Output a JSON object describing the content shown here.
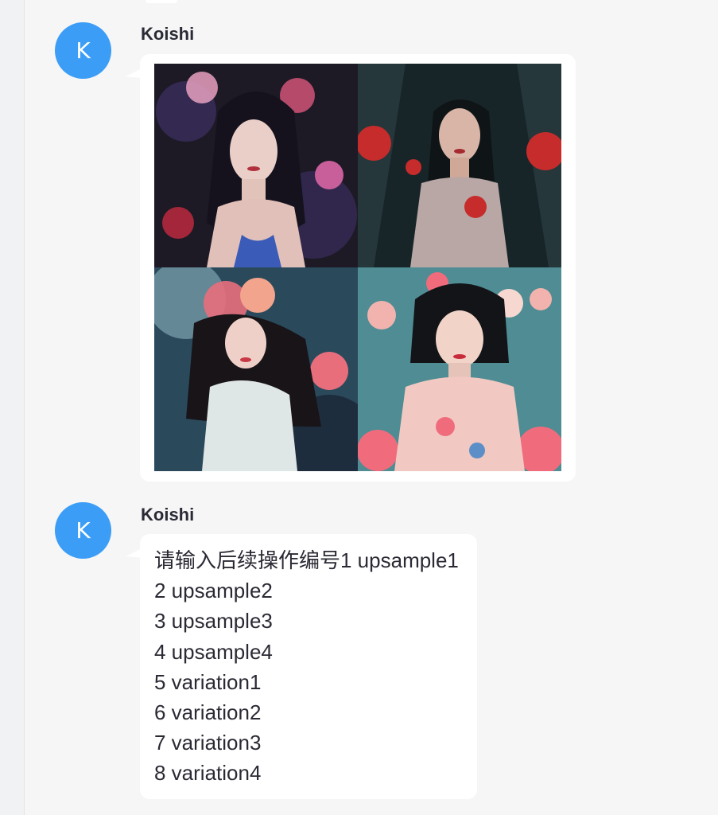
{
  "messages": [
    {
      "avatar_letter": "K",
      "username": "Koishi",
      "image_grid": {
        "tiles": [
          {
            "index": 1,
            "palette": [
              "#1d1a26",
              "#3a2d5c",
              "#b64a6a",
              "#e8a0c0"
            ]
          },
          {
            "index": 2,
            "palette": [
              "#172529",
              "#2e4446",
              "#c62c2b",
              "#d9b5a8"
            ]
          },
          {
            "index": 3,
            "palette": [
              "#2a4a5c",
              "#7fa2b0",
              "#e86e7c",
              "#f3d6d2"
            ]
          },
          {
            "index": 4,
            "palette": [
              "#4f8c93",
              "#99c7c6",
              "#f06c7c",
              "#f7d8d0"
            ]
          }
        ]
      }
    },
    {
      "avatar_letter": "K",
      "username": "Koishi",
      "lines": [
        "请输入后续操作编号1 upsample1",
        "2 upsample2",
        "3 upsample3",
        "4 upsample4",
        "5 variation1",
        "6 variation2",
        "7 variation3",
        "8 variation4"
      ]
    }
  ],
  "colors": {
    "avatar": "#3b9df5",
    "background": "#f6f6f7",
    "bubble": "#ffffff"
  }
}
